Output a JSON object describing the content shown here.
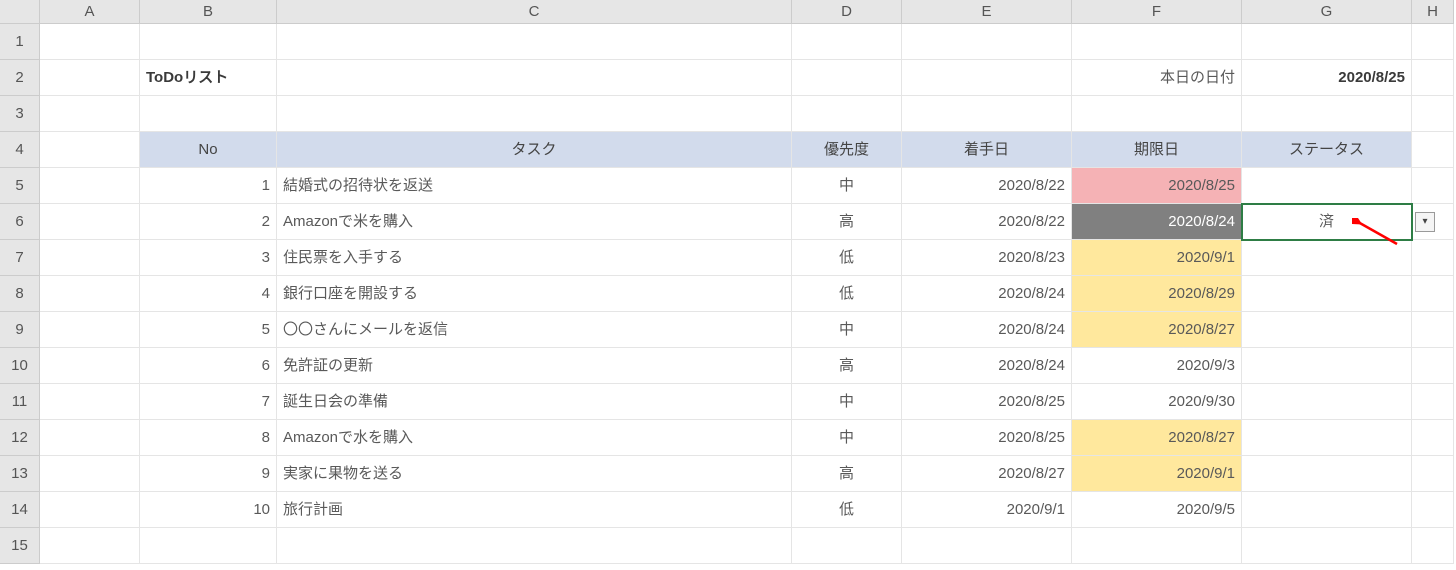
{
  "columns": [
    "A",
    "B",
    "C",
    "D",
    "E",
    "F",
    "G",
    "H"
  ],
  "rownums": [
    "1",
    "2",
    "3",
    "4",
    "5",
    "6",
    "7",
    "8",
    "9",
    "10",
    "11",
    "12",
    "13",
    "14",
    "15"
  ],
  "title": "ToDoリスト",
  "todayLabel": "本日の日付",
  "todayDate": "2020/8/25",
  "headers": {
    "no": "No",
    "task": "タスク",
    "priority": "優先度",
    "start": "着手日",
    "due": "期限日",
    "status": "ステータス"
  },
  "rows": [
    {
      "no": "1",
      "task": "結婚式の招待状を返送",
      "priority": "中",
      "start": "2020/8/22",
      "due": "2020/8/25",
      "dueHl": "pink",
      "status": ""
    },
    {
      "no": "2",
      "task": "Amazonで米を購入",
      "priority": "高",
      "start": "2020/8/22",
      "due": "2020/8/24",
      "dueHl": "gray",
      "status": "済"
    },
    {
      "no": "3",
      "task": "住民票を入手する",
      "priority": "低",
      "start": "2020/8/23",
      "due": "2020/9/1",
      "dueHl": "yellow",
      "status": ""
    },
    {
      "no": "4",
      "task": "銀行口座を開設する",
      "priority": "低",
      "start": "2020/8/24",
      "due": "2020/8/29",
      "dueHl": "yellow",
      "status": ""
    },
    {
      "no": "5",
      "task": "〇〇さんにメールを返信",
      "priority": "中",
      "start": "2020/8/24",
      "due": "2020/8/27",
      "dueHl": "yellow",
      "status": ""
    },
    {
      "no": "6",
      "task": "免許証の更新",
      "priority": "高",
      "start": "2020/8/24",
      "due": "2020/9/3",
      "dueHl": "",
      "status": ""
    },
    {
      "no": "7",
      "task": "誕生日会の準備",
      "priority": "中",
      "start": "2020/8/25",
      "due": "2020/9/30",
      "dueHl": "",
      "status": ""
    },
    {
      "no": "8",
      "task": "Amazonで水を購入",
      "priority": "中",
      "start": "2020/8/25",
      "due": "2020/8/27",
      "dueHl": "yellow",
      "status": ""
    },
    {
      "no": "9",
      "task": "実家に果物を送る",
      "priority": "高",
      "start": "2020/8/27",
      "due": "2020/9/1",
      "dueHl": "yellow",
      "status": ""
    },
    {
      "no": "10",
      "task": "旅行計画",
      "priority": "低",
      "start": "2020/9/1",
      "due": "2020/9/5",
      "dueHl": "",
      "status": ""
    }
  ],
  "colors": {
    "headerBg": "#d2dbec",
    "pink": "#f5b2b5",
    "yellow": "#ffe89d",
    "gray": "#808080",
    "selection": "#2e7d45"
  }
}
